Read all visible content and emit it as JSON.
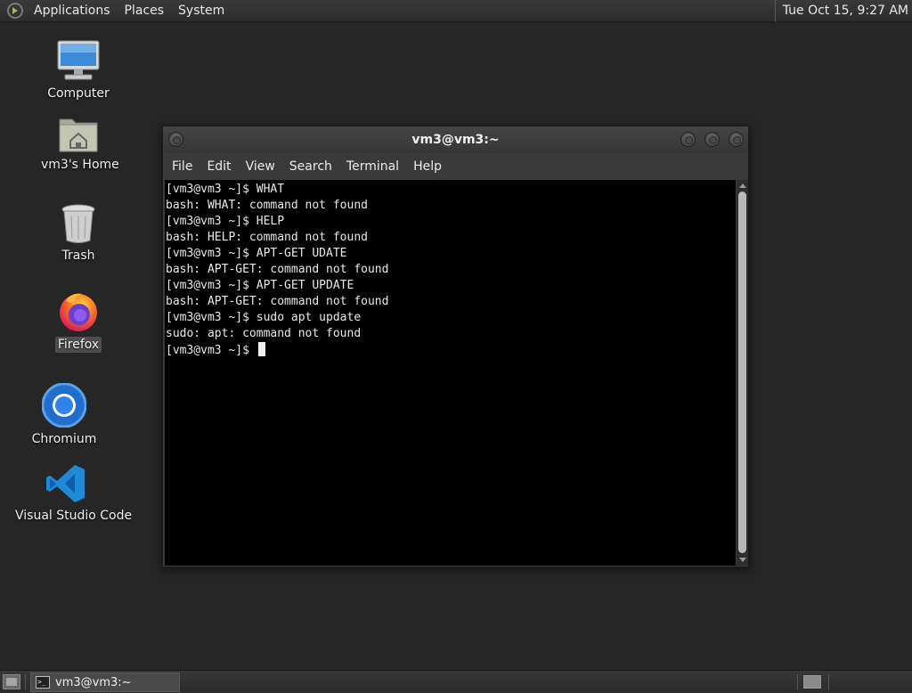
{
  "top_panel": {
    "menus": [
      "Applications",
      "Places",
      "System"
    ],
    "clock": "Tue Oct 15,  9:27 AM"
  },
  "desktop_icons": [
    {
      "label": "Computer",
      "icon": "computer-icon"
    },
    {
      "label": "vm3's Home",
      "icon": "home-folder-icon"
    },
    {
      "label": "Trash",
      "icon": "trash-icon"
    },
    {
      "label": "Firefox",
      "icon": "firefox-icon"
    },
    {
      "label": "Chromium",
      "icon": "chromium-icon"
    },
    {
      "label": "Visual Studio Code",
      "icon": "vscode-icon"
    }
  ],
  "terminal": {
    "title": "vm3@vm3:~",
    "menus": [
      "File",
      "Edit",
      "View",
      "Search",
      "Terminal",
      "Help"
    ],
    "lines": [
      "[vm3@vm3 ~]$ WHAT",
      "bash: WHAT: command not found",
      "[vm3@vm3 ~]$ HELP",
      "bash: HELP: command not found",
      "[vm3@vm3 ~]$ APT-GET UDATE",
      "bash: APT-GET: command not found",
      "[vm3@vm3 ~]$ APT-GET UPDATE",
      "bash: APT-GET: command not found",
      "[vm3@vm3 ~]$ sudo apt update",
      "sudo: apt: command not found"
    ],
    "prompt": "[vm3@vm3 ~]$ "
  },
  "taskbar": {
    "window_button": "vm3@vm3:~"
  },
  "colors": {
    "desktop_bg": "#262626",
    "terminal_bg": "#000000",
    "terminal_fg": "#e8e8e8"
  }
}
